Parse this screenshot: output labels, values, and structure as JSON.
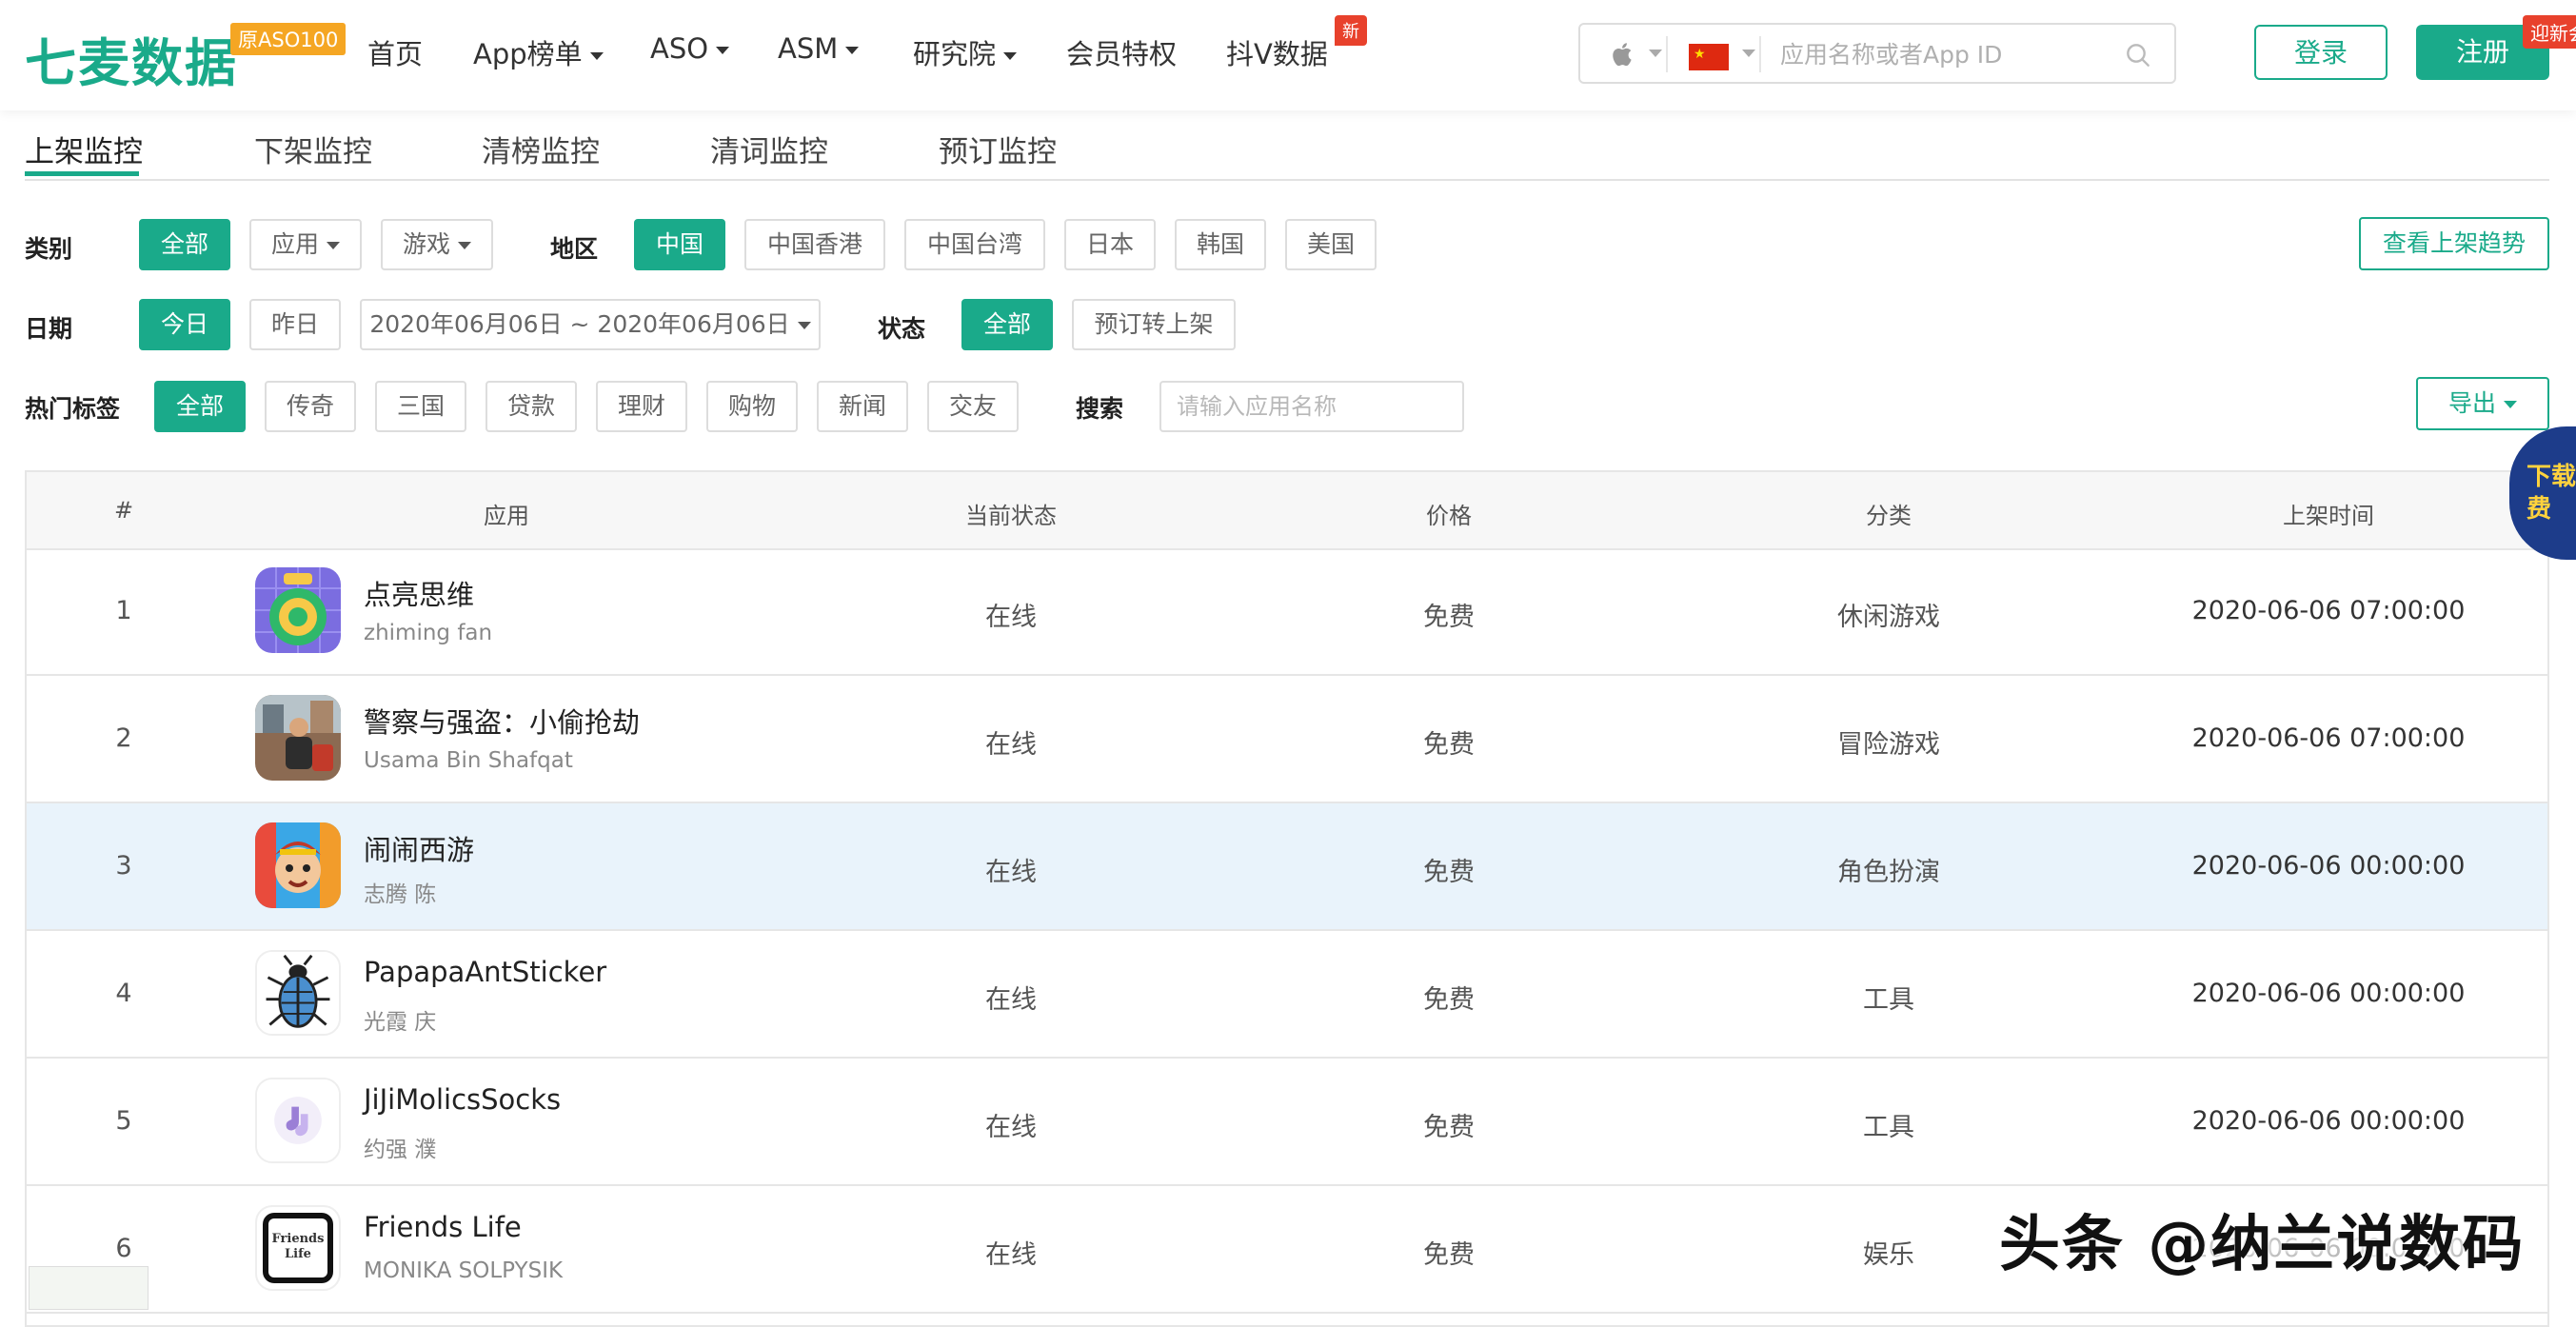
{
  "header": {
    "logo": "七麦数据",
    "logo_badge": "原ASO100",
    "nav": [
      {
        "label": "首页"
      },
      {
        "label": "App榜单"
      },
      {
        "label": "ASO"
      },
      {
        "label": "ASM"
      },
      {
        "label": "研究院"
      },
      {
        "label": "会员特权"
      },
      {
        "label": "抖V数据"
      }
    ],
    "nav_new_badge": "新",
    "search": {
      "platform_icon": "apple-icon",
      "region_icon": "china-flag-icon",
      "placeholder": "应用名称或者App ID"
    },
    "login_label": "登录",
    "register_label": "注册",
    "welcome_badge": "迎新会"
  },
  "tabs": [
    "上架监控",
    "下架监控",
    "清榜监控",
    "清词监控",
    "预订监控"
  ],
  "filters": {
    "category_label": "类别",
    "category_options": [
      "全部",
      "应用",
      "游戏"
    ],
    "region_label": "地区",
    "region_options": [
      "中国",
      "中国香港",
      "中国台湾",
      "日本",
      "韩国",
      "美国"
    ],
    "trend_button": "查看上架趋势",
    "date_label": "日期",
    "date_options": [
      "今日",
      "昨日"
    ],
    "date_range": "2020年06月06日 ~ 2020年06月06日",
    "status_label": "状态",
    "status_options": [
      "全部",
      "预订转上架"
    ],
    "tags_label": "热门标签",
    "tag_options": [
      "全部",
      "传奇",
      "三国",
      "贷款",
      "理财",
      "购物",
      "新闻",
      "交友"
    ],
    "search_label": "搜索",
    "search_placeholder": "请输入应用名称",
    "export_label": "导出"
  },
  "table": {
    "headers": [
      "#",
      "应用",
      "当前状态",
      "价格",
      "分类",
      "上架时间"
    ],
    "rows": [
      {
        "rank": "1",
        "name": "点亮思维",
        "developer": "zhiming fan",
        "status": "在线",
        "price": "免费",
        "category": "休闲游戏",
        "time": "2020-06-06 07:00:00",
        "highlighted": false
      },
      {
        "rank": "2",
        "name": "警察与强盗：小偷抢劫",
        "developer": "Usama Bin Shafqat",
        "status": "在线",
        "price": "免费",
        "category": "冒险游戏",
        "time": "2020-06-06 07:00:00",
        "highlighted": false
      },
      {
        "rank": "3",
        "name": "闹闹西游",
        "developer": "志腾 陈",
        "status": "在线",
        "price": "免费",
        "category": "角色扮演",
        "time": "2020-06-06 00:00:00",
        "highlighted": true
      },
      {
        "rank": "4",
        "name": "PapapaAntSticker",
        "developer": "光霞 庆",
        "status": "在线",
        "price": "免费",
        "category": "工具",
        "time": "2020-06-06 00:00:00",
        "highlighted": false
      },
      {
        "rank": "5",
        "name": "JiJiMolicsSocks",
        "developer": "约强 濮",
        "status": "在线",
        "price": "免费",
        "category": "工具",
        "time": "2020-06-06 00:00:00",
        "highlighted": false
      },
      {
        "rank": "6",
        "name": "Friends Life",
        "developer": "MONIKA SOLPYSIK",
        "status": "在线",
        "price": "免费",
        "category": "娱乐",
        "time": "2020-06-06 00:00:00",
        "highlighted": false
      }
    ]
  },
  "side_promo": "下载 免费",
  "watermark": "头条 @纳兰说数码",
  "icon_text": {
    "friends_life": "Friends Life"
  },
  "colors": {
    "accent": "#1aaa8a",
    "badge_red": "#e8412c",
    "badge_orange": "#f5a623",
    "row_highlight": "#e9f3fb"
  }
}
